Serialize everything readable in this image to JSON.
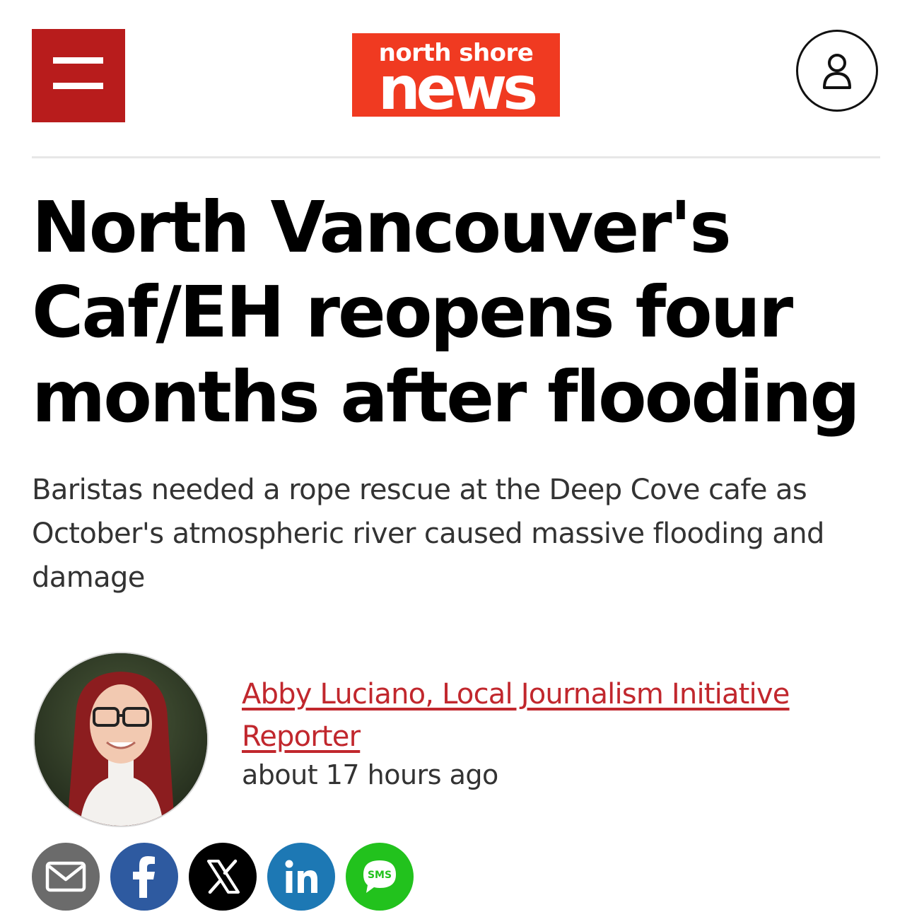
{
  "header": {
    "menu_icon": "hamburger-menu-icon",
    "logo": {
      "line1": "north shore",
      "line2": "news"
    },
    "account_icon": "user-account-icon",
    "colors": {
      "menu_bg": "#b81c1c",
      "logo_bg": "#f03a21"
    }
  },
  "article": {
    "headline": "North Vancouver's Caf/EH reopens four months after flooding",
    "subheadline": "Baristas needed a rope rescue at the Deep Cove cafe as October's atmospheric river caused massive flooding and damage",
    "byline": {
      "author": "Abby Luciano, Local Journalism Initiative Reporter",
      "timestamp": "about 17 hours ago",
      "link_color": "#c1272d"
    }
  },
  "share": [
    {
      "name": "email",
      "icon": "email-icon",
      "color": "#6b6b6b"
    },
    {
      "name": "facebook",
      "icon": "facebook-icon",
      "color": "#2e5aa0"
    },
    {
      "name": "x",
      "icon": "x-icon",
      "color": "#000000"
    },
    {
      "name": "linkedin",
      "icon": "linkedin-icon",
      "color": "#1d78b4"
    },
    {
      "name": "sms",
      "icon": "sms-icon",
      "label": "SMS",
      "color": "#22c21d"
    }
  ]
}
